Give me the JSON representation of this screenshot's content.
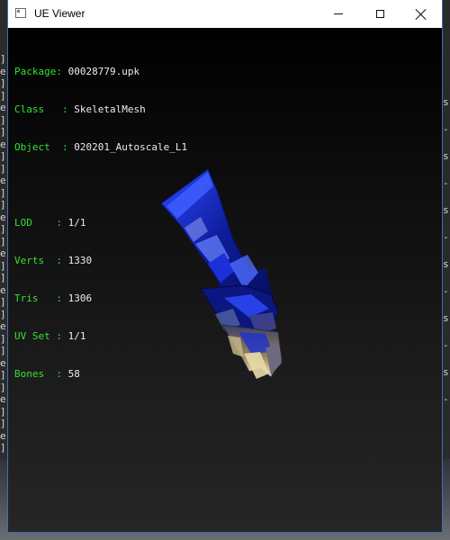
{
  "window": {
    "title": "UE Viewer"
  },
  "object_info": {
    "package_label": "Package",
    "package": "00028779.upk",
    "class_label": "Class",
    "class": "SkeletalMesh",
    "object_label": "Object",
    "object": "020201_Autoscale_L1"
  },
  "mesh_stats": {
    "lod_label": "LOD",
    "lod": "1/1",
    "verts_label": "Verts",
    "verts": "1330",
    "tris_label": "Tris",
    "tris": "1306",
    "uv_set_label": "UV Set",
    "uv_set": "1/1",
    "bones_label": "Bones",
    "bones": "58"
  },
  "background_window": {
    "left_glyphs": [
      "]",
      "e",
      "]",
      "]",
      "e",
      "]",
      "]",
      "e",
      "]",
      "]",
      "e",
      "]",
      "]",
      "e",
      "]",
      "]",
      "e",
      "]",
      "]",
      "e",
      "]",
      "]",
      "e",
      "]",
      "]",
      "e",
      "]",
      "]",
      "e",
      "]",
      "]",
      "e",
      "]"
    ],
    "right_glyphs": [
      "s",
      "-",
      "s",
      "-",
      "s",
      "-",
      "s",
      "-",
      "s",
      "-",
      "s",
      "-"
    ]
  },
  "colors": {
    "label_green": "#33e233",
    "value_white": "#ececec",
    "mesh_blue": "#1b2fd1"
  }
}
